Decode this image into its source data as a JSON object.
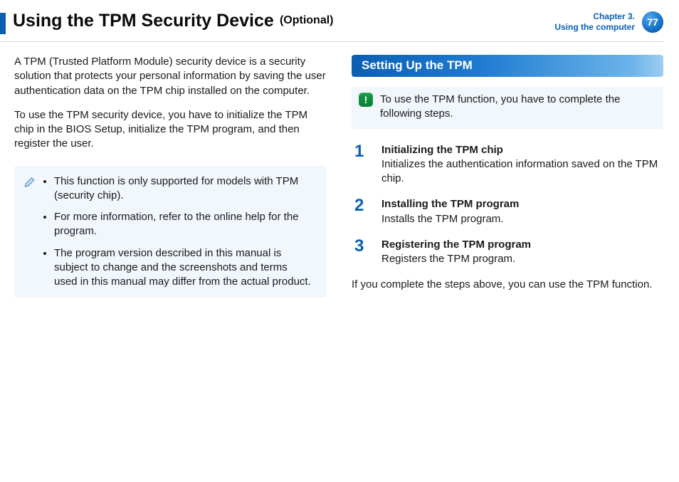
{
  "header": {
    "title": "Using the TPM Security Device",
    "suffix": "(Optional)",
    "chapter_line1": "Chapter 3.",
    "chapter_line2": "Using the computer",
    "page_number": "77"
  },
  "left": {
    "p1": "A TPM (Trusted Platform Module) security device is a security solution that protects your personal information by saving the user authentication data on the TPM chip installed on the computer.",
    "p2": "To use the TPM security device, you have to initialize the TPM chip in the BIOS Setup, initialize the TPM program, and then register the user.",
    "note_items": [
      "This function is only supported for models with TPM (security chip).",
      "For more information, refer to the online help for the program.",
      "The program version described in this manual is subject to change and the screenshots and terms used in this manual may differ from the actual product."
    ]
  },
  "right": {
    "section_title": "Setting Up the TPM",
    "alert": "To use the TPM function, you have to complete the following steps.",
    "steps": [
      {
        "num": "1",
        "title": "Initializing the TPM chip",
        "body": "Initializes the authentication information saved on the TPM chip."
      },
      {
        "num": "2",
        "title": "Installing the TPM program",
        "body": "Installs the TPM program."
      },
      {
        "num": "3",
        "title": "Registering the TPM program",
        "body": "Registers the TPM program."
      }
    ],
    "closing": "If you complete the steps above, you can use the TPM function."
  }
}
